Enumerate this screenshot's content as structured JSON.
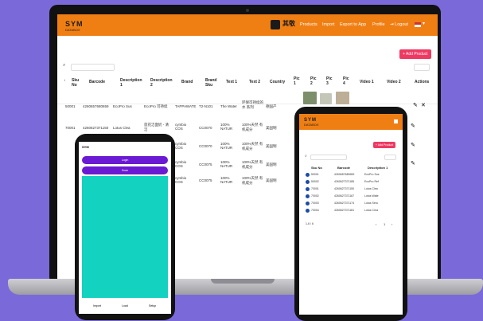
{
  "laptop": {
    "brand": "SYM",
    "brand_sub": "DATABOX",
    "partner": "其敬",
    "nav": [
      "Products",
      "Import",
      "Export to App",
      "Profile",
      "Logout"
    ],
    "add_product": "+ Add Product",
    "columns": [
      "Sku No",
      "Barcode",
      "Description 1",
      "Description 2",
      "Brand",
      "Brand Sku",
      "Text 1",
      "Text 2",
      "Country",
      "Pic 1",
      "Pic 2",
      "Pic 3",
      "Pic 4",
      "Video 1",
      "Video 2",
      "Actions"
    ],
    "rows": [
      {
        "sku": "50001",
        "barcode": "4260657680659",
        "d1": "EcoPro Sus",
        "d2": "EcoPro 可持续",
        "brand": "TAPPAWATE",
        "bsku": "T2-N101",
        "t1": "The Water",
        "t2": "环保可持续的水 系列",
        "country": "德国产"
      },
      {
        "sku": "70001",
        "barcode": "4260627371150",
        "d1": "Lotus Clea",
        "d2": "莲花洁面奶 - 清洁",
        "brand": "cymbio COS",
        "bsku": "CC0070",
        "t1": "100% NATUR",
        "t2": "100%天然 有机成分",
        "country": "美国制"
      },
      {
        "sku": "",
        "barcode": "",
        "d1": "",
        "d2": "",
        "brand": "cymbio COS",
        "bsku": "CC0070",
        "t1": "100% NATUR",
        "t2": "100%天然 有机成分",
        "country": "美国制"
      },
      {
        "sku": "",
        "barcode": "",
        "d1": "",
        "d2": "",
        "brand": "cymbio COS",
        "bsku": "CC0075",
        "t1": "100% NATUR",
        "t2": "100%天然 有机成分",
        "country": "美国制"
      },
      {
        "sku": "",
        "barcode": "",
        "d1": "",
        "d2": "",
        "brand": "cymbio COS",
        "bsku": "CC0075",
        "t1": "100% NATUR",
        "t2": "100%天然 有机成分",
        "country": "美国制"
      }
    ]
  },
  "phone_left": {
    "header": "SYM",
    "btn1": "Login",
    "btn2": "Scan",
    "footer": [
      "Import",
      "Load",
      "Setup"
    ]
  },
  "phone_right": {
    "brand": "SYM",
    "brand_sub": "DATABOX",
    "add_product": "+ Add Product",
    "columns": [
      "Sku No",
      "Barcode",
      "Description 1"
    ],
    "rows": [
      {
        "sku": "50001",
        "barcode": "4260657680659",
        "d1": "EcoPro Sus"
      },
      {
        "sku": "50002",
        "barcode": "4260627371185",
        "d1": "EcoPro Ref"
      },
      {
        "sku": "70001",
        "barcode": "4260627371150",
        "d1": "Lotus Clea"
      },
      {
        "sku": "70002",
        "barcode": "4260627371167",
        "d1": "Lotus Wate"
      },
      {
        "sku": "70003",
        "barcode": "4260627371174",
        "d1": "Lotus Seru"
      },
      {
        "sku": "70004",
        "barcode": "4260627371181",
        "d1": "Lotus Crea"
      }
    ],
    "pagination": "1-6 / 6",
    "page": "1"
  }
}
